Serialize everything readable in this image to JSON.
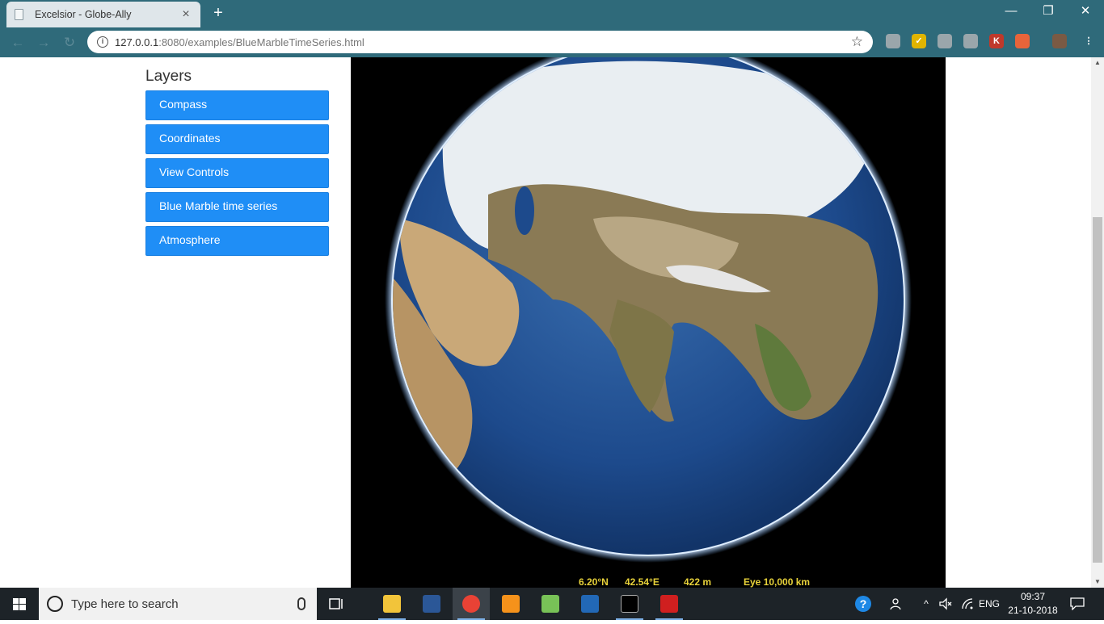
{
  "browser": {
    "tab_title": "Excelsior - Globe-Ally",
    "tab_close": "×",
    "new_tab": "+",
    "url_host": "127.0.0.1",
    "url_rest": ":8080/examples/BlueMarbleTimeSeries.html",
    "minimize": "—",
    "restore": "❐",
    "close": "✕",
    "back": "←",
    "forward": "→",
    "reload": "↻",
    "star": "☆",
    "info": "i",
    "extensions": [
      {
        "name": "ext-circle-icon",
        "label": "",
        "color": "#9aa6ab"
      },
      {
        "name": "ext-check-icon",
        "label": "✓",
        "color": "#e0b400"
      },
      {
        "name": "ext-pdf-icon",
        "label": "",
        "color": "#9aa6ab"
      },
      {
        "name": "ext-pen-icon",
        "label": "",
        "color": "#9aa6ab"
      },
      {
        "name": "ext-k-icon",
        "label": "K",
        "color": "#c0392b"
      },
      {
        "name": "ext-duck-icon",
        "label": "",
        "color": "#e8643a"
      },
      {
        "name": "ext-avatar-icon",
        "label": "",
        "color": "#7a5a44"
      },
      {
        "name": "ext-menu-icon",
        "label": "⋮",
        "color": "#2f6a7a"
      }
    ]
  },
  "sidebar": {
    "heading": "Layers",
    "buttons": [
      {
        "label": "Compass"
      },
      {
        "label": "Coordinates"
      },
      {
        "label": "View Controls"
      },
      {
        "label": "Blue Marble time series"
      },
      {
        "label": "Atmosphere"
      }
    ]
  },
  "globe": {
    "latitude": "6.20°N",
    "longitude": "42.54°E",
    "elevation": "422 m",
    "eye": "Eye  10,000 km"
  },
  "taskbar": {
    "search_placeholder": "Type here to search",
    "language": "ENG",
    "time": "09:37",
    "date": "21-10-2018",
    "apps": [
      {
        "name": "file-explorer-icon",
        "color": "#f2c43a"
      },
      {
        "name": "word-icon",
        "color": "#2b5797"
      },
      {
        "name": "chrome-icon",
        "color": "#e94235"
      },
      {
        "name": "sublime-icon",
        "color": "#f5921b"
      },
      {
        "name": "android-studio-icon",
        "color": "#78c257"
      },
      {
        "name": "r-icon",
        "color": "#2268b6"
      },
      {
        "name": "terminal-icon",
        "color": "#000000"
      },
      {
        "name": "acrobat-icon",
        "color": "#d01f1f"
      }
    ]
  }
}
